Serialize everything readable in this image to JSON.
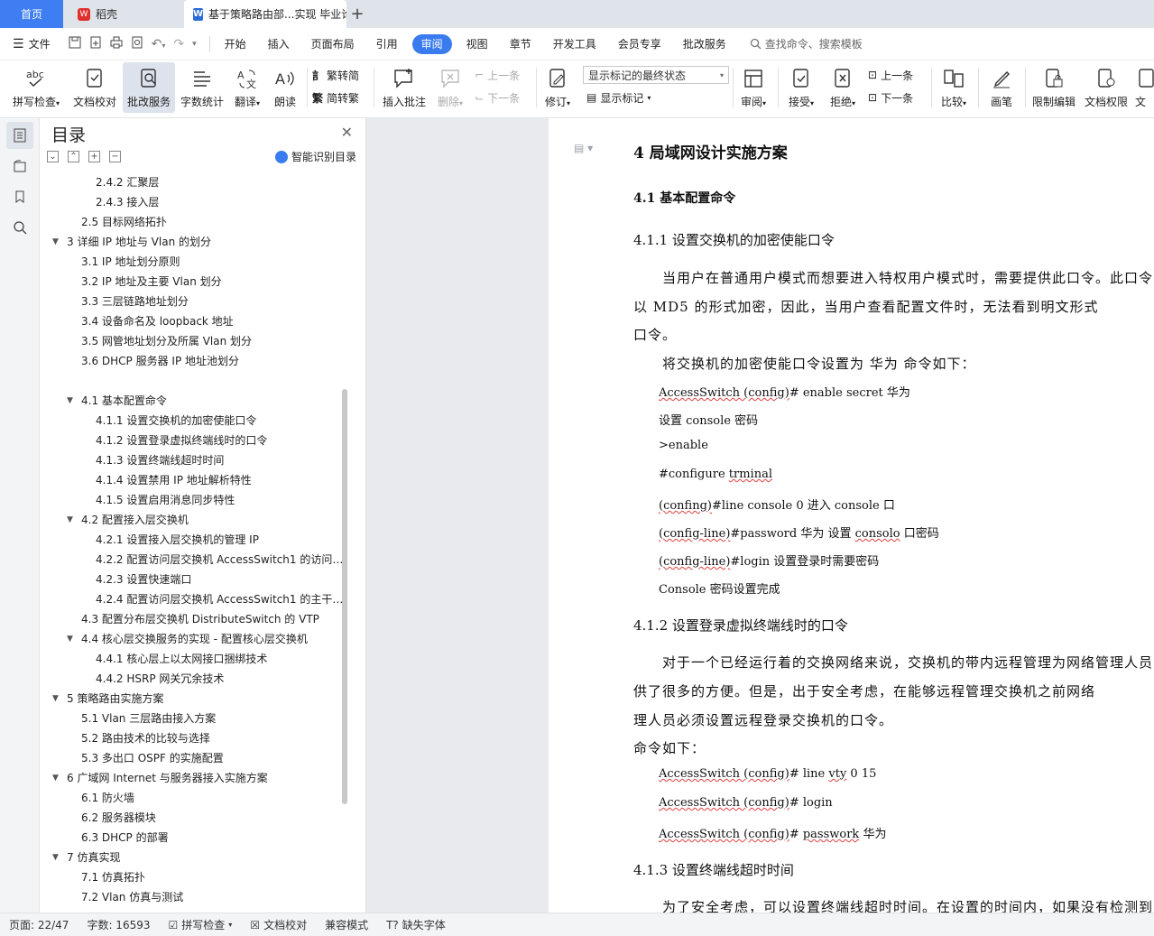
{
  "tabs": {
    "home": "首页",
    "wps": "稻壳",
    "doc": "基于策略路由部...实现 毕业论",
    "plus": "+"
  },
  "menu": {
    "file": "文件",
    "items": [
      "开始",
      "插入",
      "页面布局",
      "引用",
      "审阅",
      "视图",
      "章节",
      "开发工具",
      "会员专享",
      "批改服务"
    ],
    "active": "审阅",
    "search": "查找命令、搜索模板"
  },
  "ribbon": {
    "spell": "拼写检查",
    "proof": "文档校对",
    "grade": "批改服务",
    "count": "字数统计",
    "translate": "翻译",
    "read": "朗读",
    "to_trad": "繁转简",
    "to_simp": "简转繁",
    "insert_comment": "插入批注",
    "delete": "删除",
    "prev": "上一条",
    "next": "下一条",
    "revise": "修订",
    "mark_select": "显示标记的最终状态",
    "show_marks": "显示标记",
    "review": "审阅",
    "accept": "接受",
    "reject": "拒绝",
    "prev2": "上一条",
    "next2": "下一条",
    "compare": "比较",
    "pen": "画笔",
    "restrict": "限制编辑",
    "perm": "文档权限",
    "more": "文"
  },
  "toc": {
    "title": "目录",
    "smart": "智能识别目录",
    "items": [
      {
        "t": "2.4.2 汇聚层",
        "l": 3
      },
      {
        "t": "2.4.3 接入层",
        "l": 3
      },
      {
        "t": "2.5 目标网络拓扑",
        "l": 2
      },
      {
        "t": "3 详细 IP 地址与 Vlan 的划分",
        "l": 1,
        "e": 1
      },
      {
        "t": "3.1 IP 地址划分原则",
        "l": 2
      },
      {
        "t": "3.2 IP 地址及主要 Vlan 划分",
        "l": 2
      },
      {
        "t": "3.3 三层链路地址划分",
        "l": 2
      },
      {
        "t": "3.4 设备命名及 loopback 地址",
        "l": 2
      },
      {
        "t": "3.5 网管地址划分及所属 Vlan 划分",
        "l": 2
      },
      {
        "t": "3.6 DHCP 服务器 IP 地址池划分",
        "l": 2
      },
      {
        "t": "4 局域网设计实施方案",
        "l": 1,
        "e": 1,
        "s": 1
      },
      {
        "t": "4.1 基本配置命令",
        "l": 2,
        "e": 1
      },
      {
        "t": "4.1.1 设置交换机的加密使能口令",
        "l": 3
      },
      {
        "t": "4.1.2 设置登录虚拟终端线时的口令",
        "l": 3
      },
      {
        "t": "4.1.3 设置终端线超时时间",
        "l": 3
      },
      {
        "t": "4.1.4 设置禁用 IP 地址解析特性",
        "l": 3
      },
      {
        "t": "4.1.5 设置启用消息同步特性",
        "l": 3
      },
      {
        "t": "4.2 配置接入层交换机",
        "l": 2,
        "e": 1
      },
      {
        "t": "4.2.1 设置接入层交换机的管理 IP",
        "l": 3
      },
      {
        "t": "4.2.2 配置访问层交换机 AccessSwitch1 的访问 …",
        "l": 3
      },
      {
        "t": "4.2.3 设置快速端口",
        "l": 3
      },
      {
        "t": "4.2.4 配置访问层交换机 AccessSwitch1 的主干 …",
        "l": 3
      },
      {
        "t": "4.3  配置分布层交换机 DistributeSwitch 的 VTP",
        "l": 2
      },
      {
        "t": "4.4  核心层交换服务的实现 - 配置核心层交换机",
        "l": 2,
        "e": 1
      },
      {
        "t": "4.4.1 核心层上以太网接口捆绑技术",
        "l": 3
      },
      {
        "t": "4.4.2 HSRP 网关冗余技术",
        "l": 3
      },
      {
        "t": "5 策略路由实施方案",
        "l": 1,
        "e": 1
      },
      {
        "t": "5.1 Vlan 三层路由接入方案",
        "l": 2
      },
      {
        "t": "5.2 路由技术的比较与选择",
        "l": 2
      },
      {
        "t": "5.3 多出口 OSPF 的实施配置",
        "l": 2
      },
      {
        "t": "6 广域网 Internet 与服务器接入实施方案",
        "l": 1,
        "e": 1
      },
      {
        "t": "6.1 防火墙",
        "l": 2
      },
      {
        "t": "6.2 服务器模块",
        "l": 2
      },
      {
        "t": "6.3 DHCP 的部署",
        "l": 2
      },
      {
        "t": "7 仿真实现",
        "l": 1,
        "e": 1
      },
      {
        "t": "7.1 仿真拓扑",
        "l": 2
      },
      {
        "t": "7.2 Vlan 仿真与测试",
        "l": 2
      }
    ]
  },
  "doc": {
    "h1": "4 局域网设计实施方案",
    "h2": "4.1 基本配置命令",
    "h3_1": "4.1.1 设置交换机的加密使能口令",
    "p1a": "当用户在普通用户模式而想要进入特权用户模式时，需要提供此口令。此口令",
    "p1b": "以 MD5 的形式加密，因此，当用户查看配置文件时，无法看到明文形式",
    "p1c": "口令。",
    "p2": "将交换机的加密使能口令设置为  华为  命令如下：",
    "c1a": "AccessSwitch (config)",
    "c1b": "# enable secret  华为",
    "c2": "设置 console 密码",
    "c3": ">enable",
    "c4a": "#configure ",
    "c4b": "trminal",
    "c5a": "(confing)",
    "c5b": "#line console 0     进入 console 口",
    "c6a": "(config-line)",
    "c6b": "#password  华为      设置 ",
    "c6c": "consolo",
    "c6d": " 口密码",
    "c7a": "(config-line)",
    "c7b": "#login                    设置登录时需要密码",
    "c8": "Console  密码设置完成",
    "h3_2": "4.1.2 设置登录虚拟终端线时的口令",
    "p3a": "对于一个已经运行着的交换网络来说，交换机的带内远程管理为网络管理人员",
    "p3b": "供了很多的方便。但是，出于安全考虑，在能够远程管理交换机之前网络",
    "p3c": "理人员必须设置远程登录交换机的口令。",
    "p4": "命令如下：",
    "d1a": "AccessSwitch (config)",
    "d1b": "# line ",
    "d1c": "vty",
    "d1d": " 0 15",
    "d2a": "AccessSwitch (config)",
    "d2b": "# login",
    "d3a": "AccessSwitch (config)",
    "d3b": "# ",
    "d3c": "passwork",
    "d3d": "  华为",
    "h3_3": "4.1.3 设置终端线超时时间",
    "p5": "为了安全考虑，可以设置终端线超时时间。在设置的时间内，如果没有检测到"
  },
  "status": {
    "page": "页面: 22/47",
    "words": "字数: 16593",
    "spell": "拼写检查",
    "proof": "文档校对",
    "compat": "兼容模式",
    "missing": "缺失字体"
  }
}
